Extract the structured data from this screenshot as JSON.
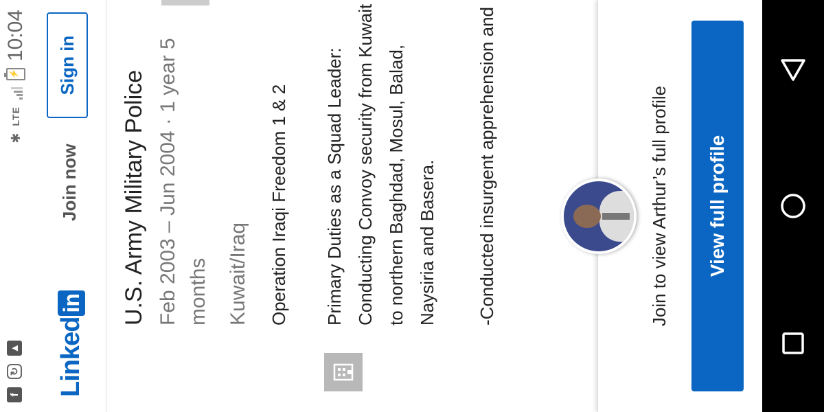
{
  "status_bar": {
    "time": "10:04",
    "network": "LTE",
    "left_icons": [
      "facebook-icon",
      "sync-icon",
      "image-icon"
    ]
  },
  "header": {
    "logo_text": "Linked",
    "logo_box": "in",
    "join_label": "Join now",
    "signin_label": "Sign in"
  },
  "experience": {
    "title": "U.S. Army Military Police",
    "dates": "Feb 2003 – Jun 2004 · 1 year 5 months",
    "location": "Kuwait/Iraq",
    "operation": "Operation Iraqi Freedom 1 & 2",
    "duties": "Primary Duties as a Squad Leader: Conducting Convoy security from Kuwait to northern Baghdad, Mosul, Balad, Naysiria and Basera.",
    "more": "-Conducted insurgent apprehension and"
  },
  "panel": {
    "join_text": "Join to view Arthur’s full profile",
    "view_button": "View full profile"
  },
  "colors": {
    "brand": "#0a66c2",
    "navbar": "#000000"
  }
}
